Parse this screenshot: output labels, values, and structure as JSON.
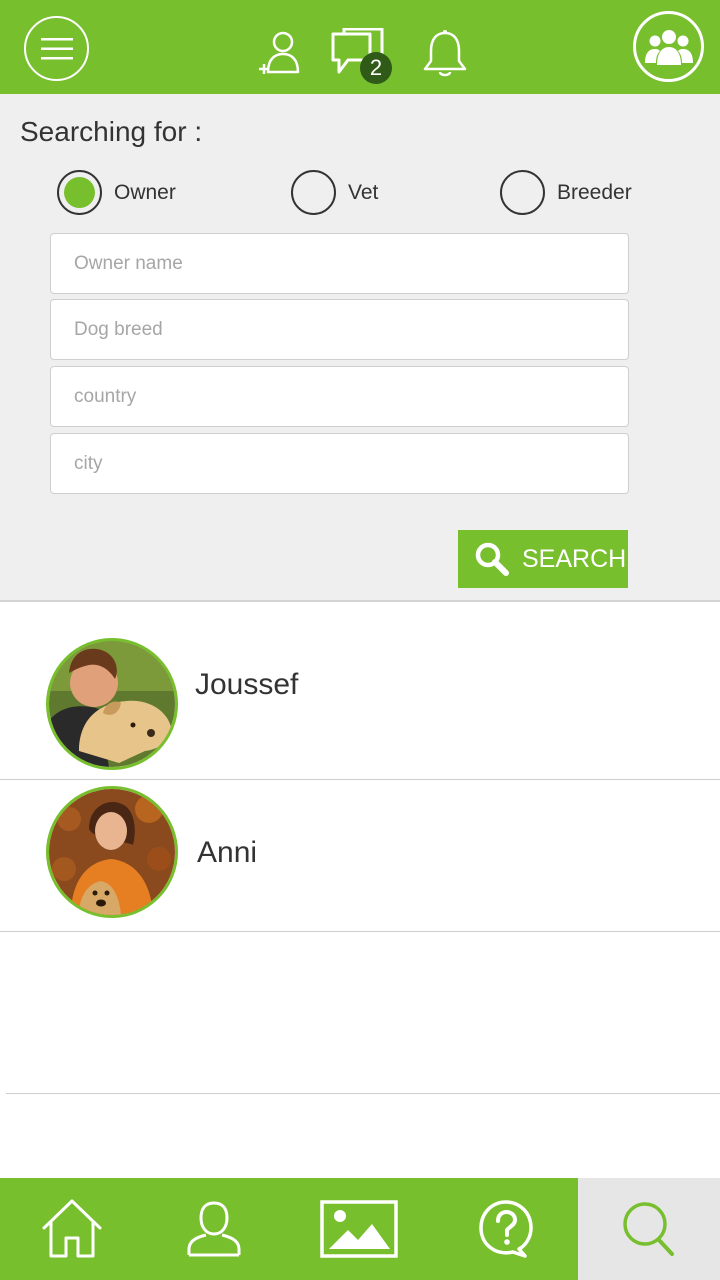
{
  "header": {
    "messages_badge": "2",
    "icons": [
      "menu-icon",
      "add-friend-icon",
      "chat-icon",
      "bell-icon",
      "group-icon"
    ]
  },
  "search": {
    "title": "Searching for :",
    "options": [
      {
        "label": "Owner",
        "selected": true
      },
      {
        "label": "Vet",
        "selected": false
      },
      {
        "label": "Breeder",
        "selected": false
      }
    ],
    "fields": {
      "owner_name_placeholder": "Owner name",
      "dog_breed_placeholder": "Dog breed",
      "country_placeholder": "country",
      "city_placeholder": "city"
    },
    "button_label": "SEARCH"
  },
  "results": [
    {
      "name": "Joussef"
    },
    {
      "name": "Anni"
    }
  ],
  "bottom_nav": {
    "items": [
      "home-icon",
      "profile-icon",
      "gallery-icon",
      "help-icon",
      "search-icon"
    ],
    "active": "search-icon"
  },
  "colors": {
    "brand": "#78bf2e",
    "badge": "#2f5a18",
    "panel": "#efefef",
    "active_tab": "#e6e6e6"
  }
}
